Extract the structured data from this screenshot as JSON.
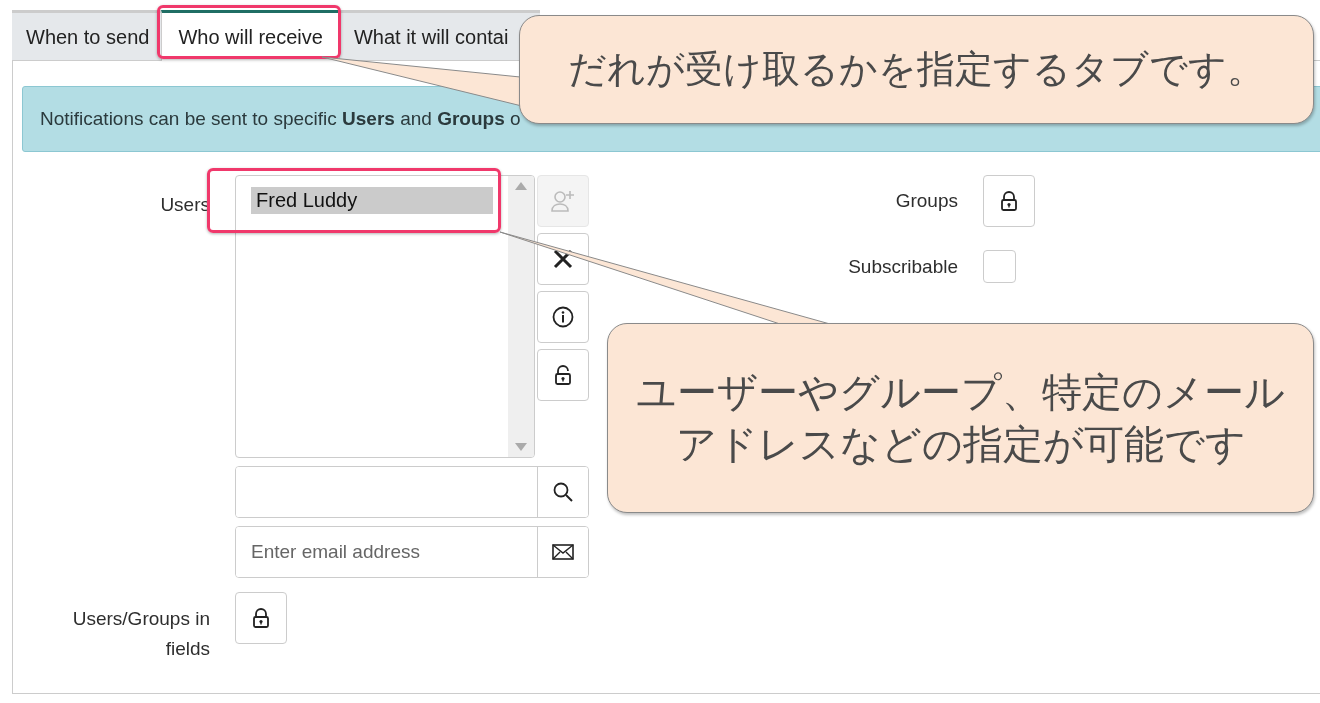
{
  "tabs": [
    {
      "label": "When to send",
      "selected": false
    },
    {
      "label": "Who will receive",
      "selected": true
    },
    {
      "label": "What it will contai",
      "selected": false
    }
  ],
  "info_banner": {
    "text": "Notifications can be sent to specific **Users** and **Groups** o"
  },
  "users": {
    "label": "Users",
    "list_items": [
      {
        "label": "Fred Luddy",
        "selected": true
      }
    ],
    "email": {
      "placeholder": "Enter email address"
    }
  },
  "groups": {
    "label": "Groups"
  },
  "subscribable": {
    "label": "Subscribable",
    "checked": false
  },
  "users_groups_in_fields": {
    "label": "Users/Groups in fields"
  },
  "callouts": [
    {
      "text": "だれが受け取るかを指定するタブです。"
    },
    {
      "text": "ユーザーやグループ、特定のメールアドレスなどの指定が可能です"
    }
  ]
}
